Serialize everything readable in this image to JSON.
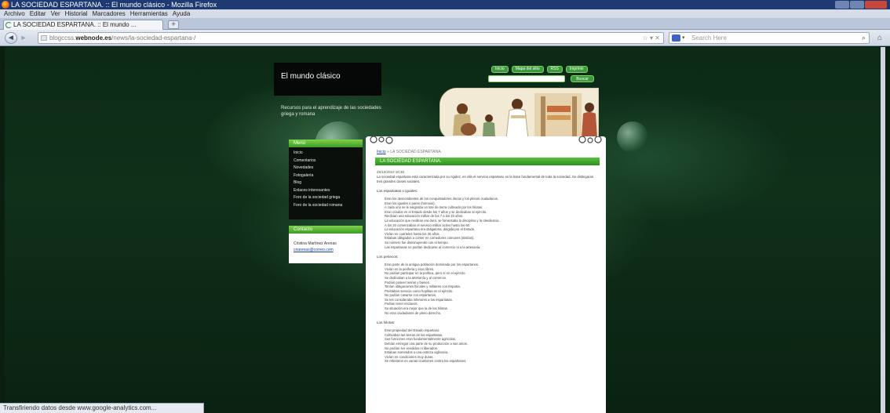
{
  "window": {
    "title": "LA SOCIEDAD ESPARTANA. :: El mundo clásico - Mozilla Firefox"
  },
  "menubar": [
    "Archivo",
    "Editar",
    "Ver",
    "Historial",
    "Marcadores",
    "Herramientas",
    "Ayuda"
  ],
  "tab": {
    "label": "LA SOCIEDAD ESPARTANA. :: El mundo ...",
    "new_tab": "+"
  },
  "navbar": {
    "back": "◄",
    "forward": "►",
    "url_prefix": "blogccss.",
    "url_domain": "webnode.es",
    "url_path": "/news/la-sociedad-espartana-/",
    "url_actions": "☆ ▾ ✕",
    "search_placeholder": "Search Here",
    "search_engine_arrow": "▾",
    "search_icon": "⌕",
    "home_icon": "⌂"
  },
  "site": {
    "title": "El mundo clásico",
    "slogan": "Recursos para el aprendizaje de las sociedades griega y romana",
    "top_nav": [
      "Inicio",
      "Mapa del sitio",
      "RSS",
      "Imprimir"
    ],
    "search_button": "Buscar"
  },
  "sidebar": {
    "menu_title": "Menú",
    "menu_items": [
      "Inicio",
      "Comentarios",
      "Novedades",
      "Fotogalería",
      "Blog",
      "Enlaces interesantes",
      "Foro de la sociedad griega",
      "Foro de la sociedad romana"
    ],
    "contact_title": "Contacto",
    "contact_name": "Cristina Martínez Arenas",
    "contact_email": "criarenas@correo.com"
  },
  "article": {
    "breadcrumb_home": "Inicio",
    "breadcrumb_sep": "»",
    "breadcrumb_current": "LA SOCIEDAD ESPARTANA.",
    "title": "LA SOCIEDAD ESPARTANA.",
    "date": "25/10/2010 18:30",
    "intro": "La sociedad espartana está caracterizada por su rigidez, en ella el servicio espartano es la base fundamental de toda la sociedad. Se distinguían tres grandes clases sociales.",
    "section1": "Los espartiatas o iguales:",
    "list1": [
      "Eran los descendientes de los conquistadores dorios y los plenos ciudadanos.",
      "Eran los iguales o pares (homoioi).",
      "A cada uno se le asignaba un lote de tierra cultivado por los hilotas.",
      "Eran criados en el Estado desde los 7 años y se dedicaban al ejército.",
      "Recibían una educación militar de los 7 a los 20 años.",
      "La educación que recibían era dura: se fomentaba la disciplina y la obediencia.",
      "A los 20 comenzaban el servicio militar activo hasta los 60.",
      "La educación espartana era obligatoria: dirigida por el Estado.",
      "Vivían en cuarteles hasta los 30 años.",
      "Estaban obligados a comer en comedores comunes (sisitías).",
      "Su número fue disminuyendo con el tiempo.",
      "Las espartanas no podían dedicarse al comercio ni a la artesanía."
    ],
    "section2": "Los periecos:",
    "list2": [
      "Eran parte de la antigua población dominada por los espartanos.",
      "Vivían en la periferia y eran libres.",
      "No podían participar en la política, pero sí en el ejército.",
      "Se dedicaban a la artesanía y al comercio.",
      "Podían poseer tierras y bienes.",
      "Tenían obligaciones fiscales y militares con Esparta.",
      "Prestaban servicio como hoplitas en el ejército.",
      "No podían casarse con espartanos.",
      "Se les consideraba inferiores a los espartiatas.",
      "Podían tener esclavos.",
      "Su situación era mejor que la de los hilotas.",
      "No eran ciudadanos de pleno derecho."
    ],
    "section3": "Los hilotas:",
    "list3": [
      "Eran propiedad del Estado espartano.",
      "Cultivaban las tierras de los espartiatas.",
      "Sus funciones eran fundamentalmente agrícolas.",
      "Debían entregar una parte de su producción a sus amos.",
      "No podían ser vendidos ni liberados.",
      "Estaban sometidos a una estricta vigilancia.",
      "Vivían en condiciones muy duras.",
      "Se rebelaron en varias ocasiones contra los espartanos."
    ]
  },
  "status": "Transfiriendo datos desde www.google-analytics.com..."
}
